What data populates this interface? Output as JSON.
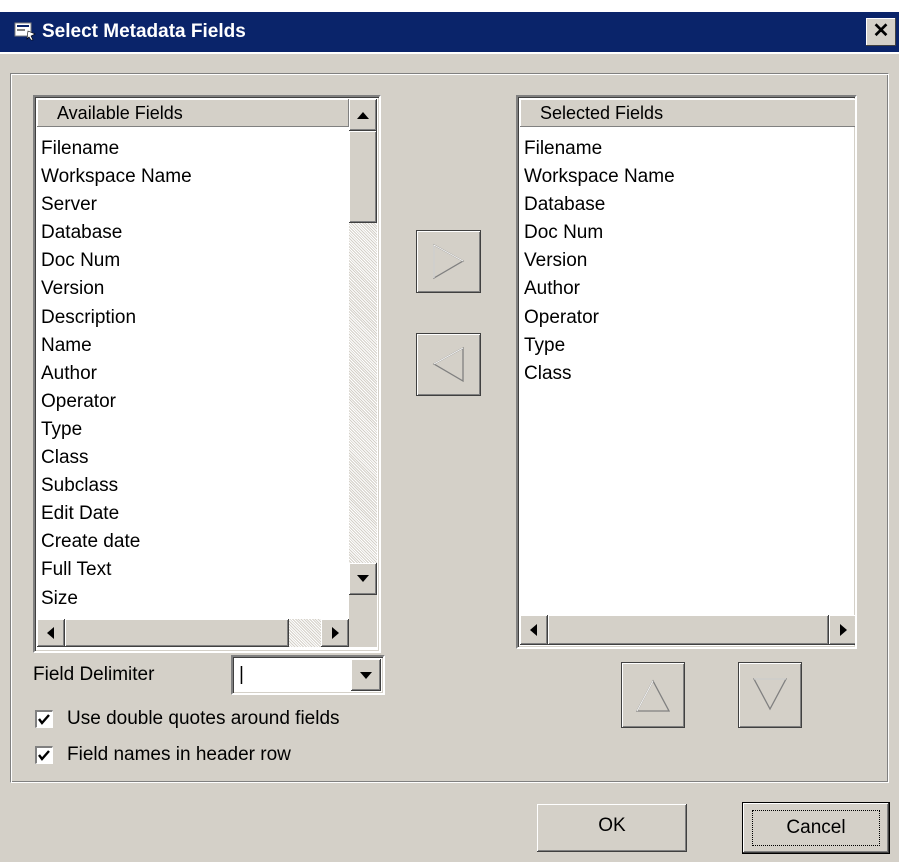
{
  "window": {
    "title": "Select Metadata Fields",
    "close_glyph": "✕"
  },
  "available": {
    "header": "Available Fields",
    "items": [
      "Filename",
      "Workspace Name",
      "Server",
      "Database",
      "Doc Num",
      "Version",
      "Description",
      "Name",
      "Author",
      "Operator",
      "Type",
      "Class",
      "Subclass",
      "Edit Date",
      "Create date",
      "Full Text",
      "Size"
    ]
  },
  "selected": {
    "header": "Selected Fields",
    "items": [
      "Filename",
      "Workspace Name",
      "Database",
      "Doc Num",
      "Version",
      "Author",
      "Operator",
      "Type",
      "Class"
    ]
  },
  "delimiter": {
    "label": "Field Delimiter",
    "value": "|"
  },
  "options": {
    "quotes_label": "Use double quotes around fields",
    "quotes_checked": true,
    "header_label": "Field names in header row",
    "header_checked": true
  },
  "buttons": {
    "ok": "OK",
    "cancel": "Cancel"
  },
  "icons": {
    "add": "triangle-right-icon",
    "remove": "triangle-left-icon",
    "move_up": "triangle-up-icon",
    "move_down": "triangle-down-icon"
  },
  "colors": {
    "titlebar": "#0a246a",
    "face": "#d4d0c8"
  }
}
